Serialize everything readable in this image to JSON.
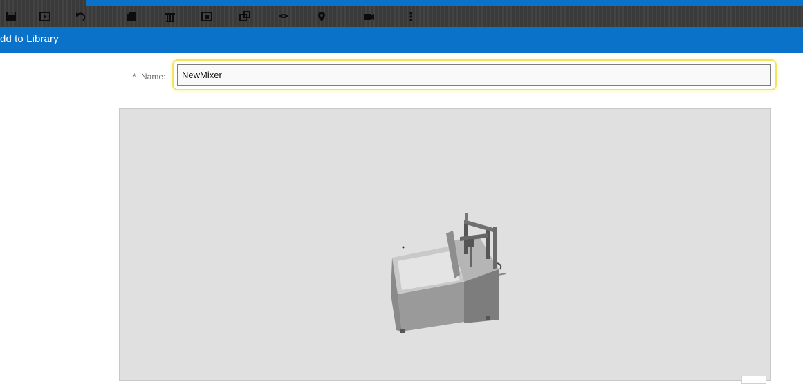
{
  "app": {
    "accent_color": "#0a73c9"
  },
  "toolbar": {
    "icons": [
      "save-icon",
      "play-icon",
      "undo-icon",
      "copy-icon",
      "delete-icon",
      "group-icon",
      "ungroup-icon",
      "render-icon",
      "location-pin-icon",
      "camera-off-icon",
      "more-vertical-icon"
    ]
  },
  "dialog": {
    "title": "dd to Library",
    "name_field": {
      "required_marker": "*",
      "label": "Name:",
      "value": "NewMixer"
    }
  }
}
